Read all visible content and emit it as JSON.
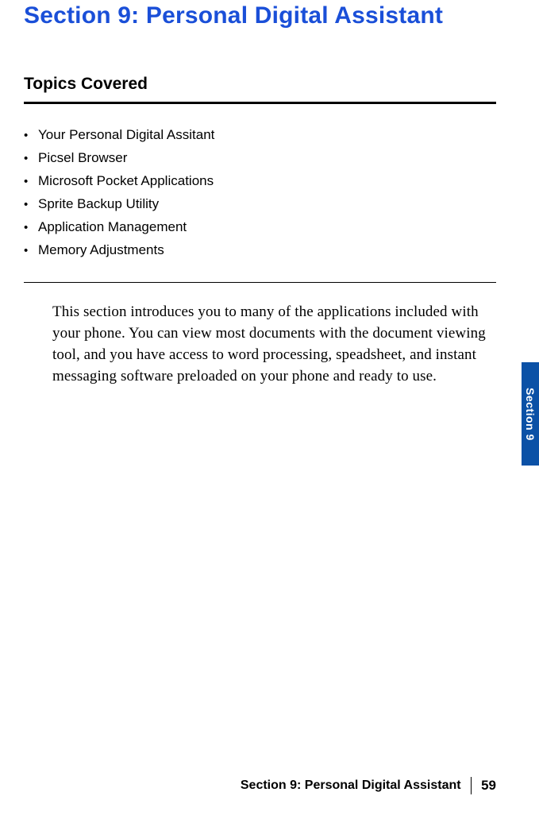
{
  "section_title": "Section 9: Personal Digital Assistant",
  "topics_heading": "Topics Covered",
  "topics": [
    "Your Personal Digital Assitant",
    "Picsel Browser",
    "Microsoft Pocket Applications",
    "Sprite Backup Utility",
    "Application Management",
    "Memory Adjustments"
  ],
  "body_paragraph": "This section introduces you to many of the applications included with your phone. You can view most documents with the document viewing tool, and you have access to word processing, speadsheet, and instant messaging software preloaded on your phone and ready to use.",
  "side_tab": "Section 9",
  "footer": {
    "title": "Section 9: Personal Digital Assistant",
    "page": "59"
  }
}
